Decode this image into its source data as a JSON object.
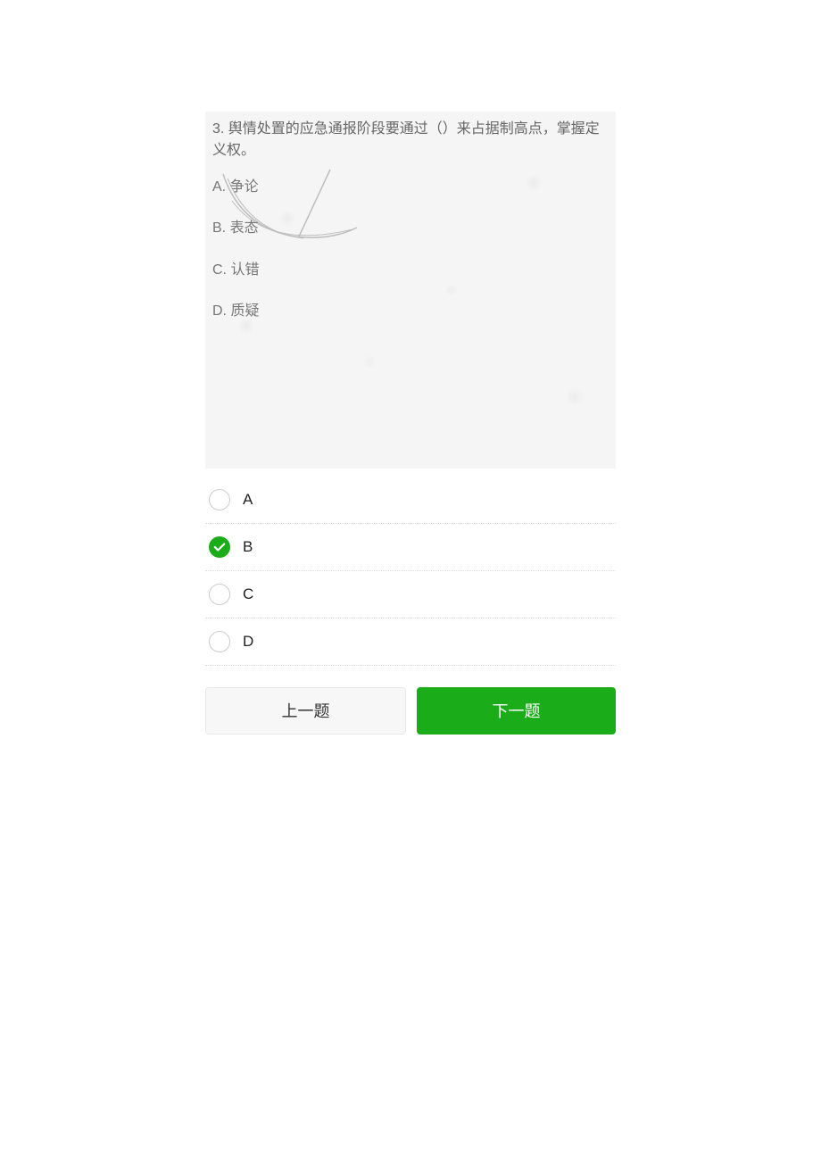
{
  "question": {
    "number": "3",
    "text": "3. 舆情处置的应急通报阶段要通过（）来占据制高点，掌握定义权。",
    "choices": [
      {
        "letter": "A",
        "text": "A. 争论"
      },
      {
        "letter": "B",
        "text": "B. 表态"
      },
      {
        "letter": "C",
        "text": "C. 认错"
      },
      {
        "letter": "D",
        "text": "D. 质疑"
      }
    ]
  },
  "answers": [
    {
      "label": "A",
      "selected": false
    },
    {
      "label": "B",
      "selected": true
    },
    {
      "label": "C",
      "selected": false
    },
    {
      "label": "D",
      "selected": false
    }
  ],
  "nav": {
    "prev_label": "上一题",
    "next_label": "下一题"
  },
  "colors": {
    "accent": "#1aad19"
  }
}
